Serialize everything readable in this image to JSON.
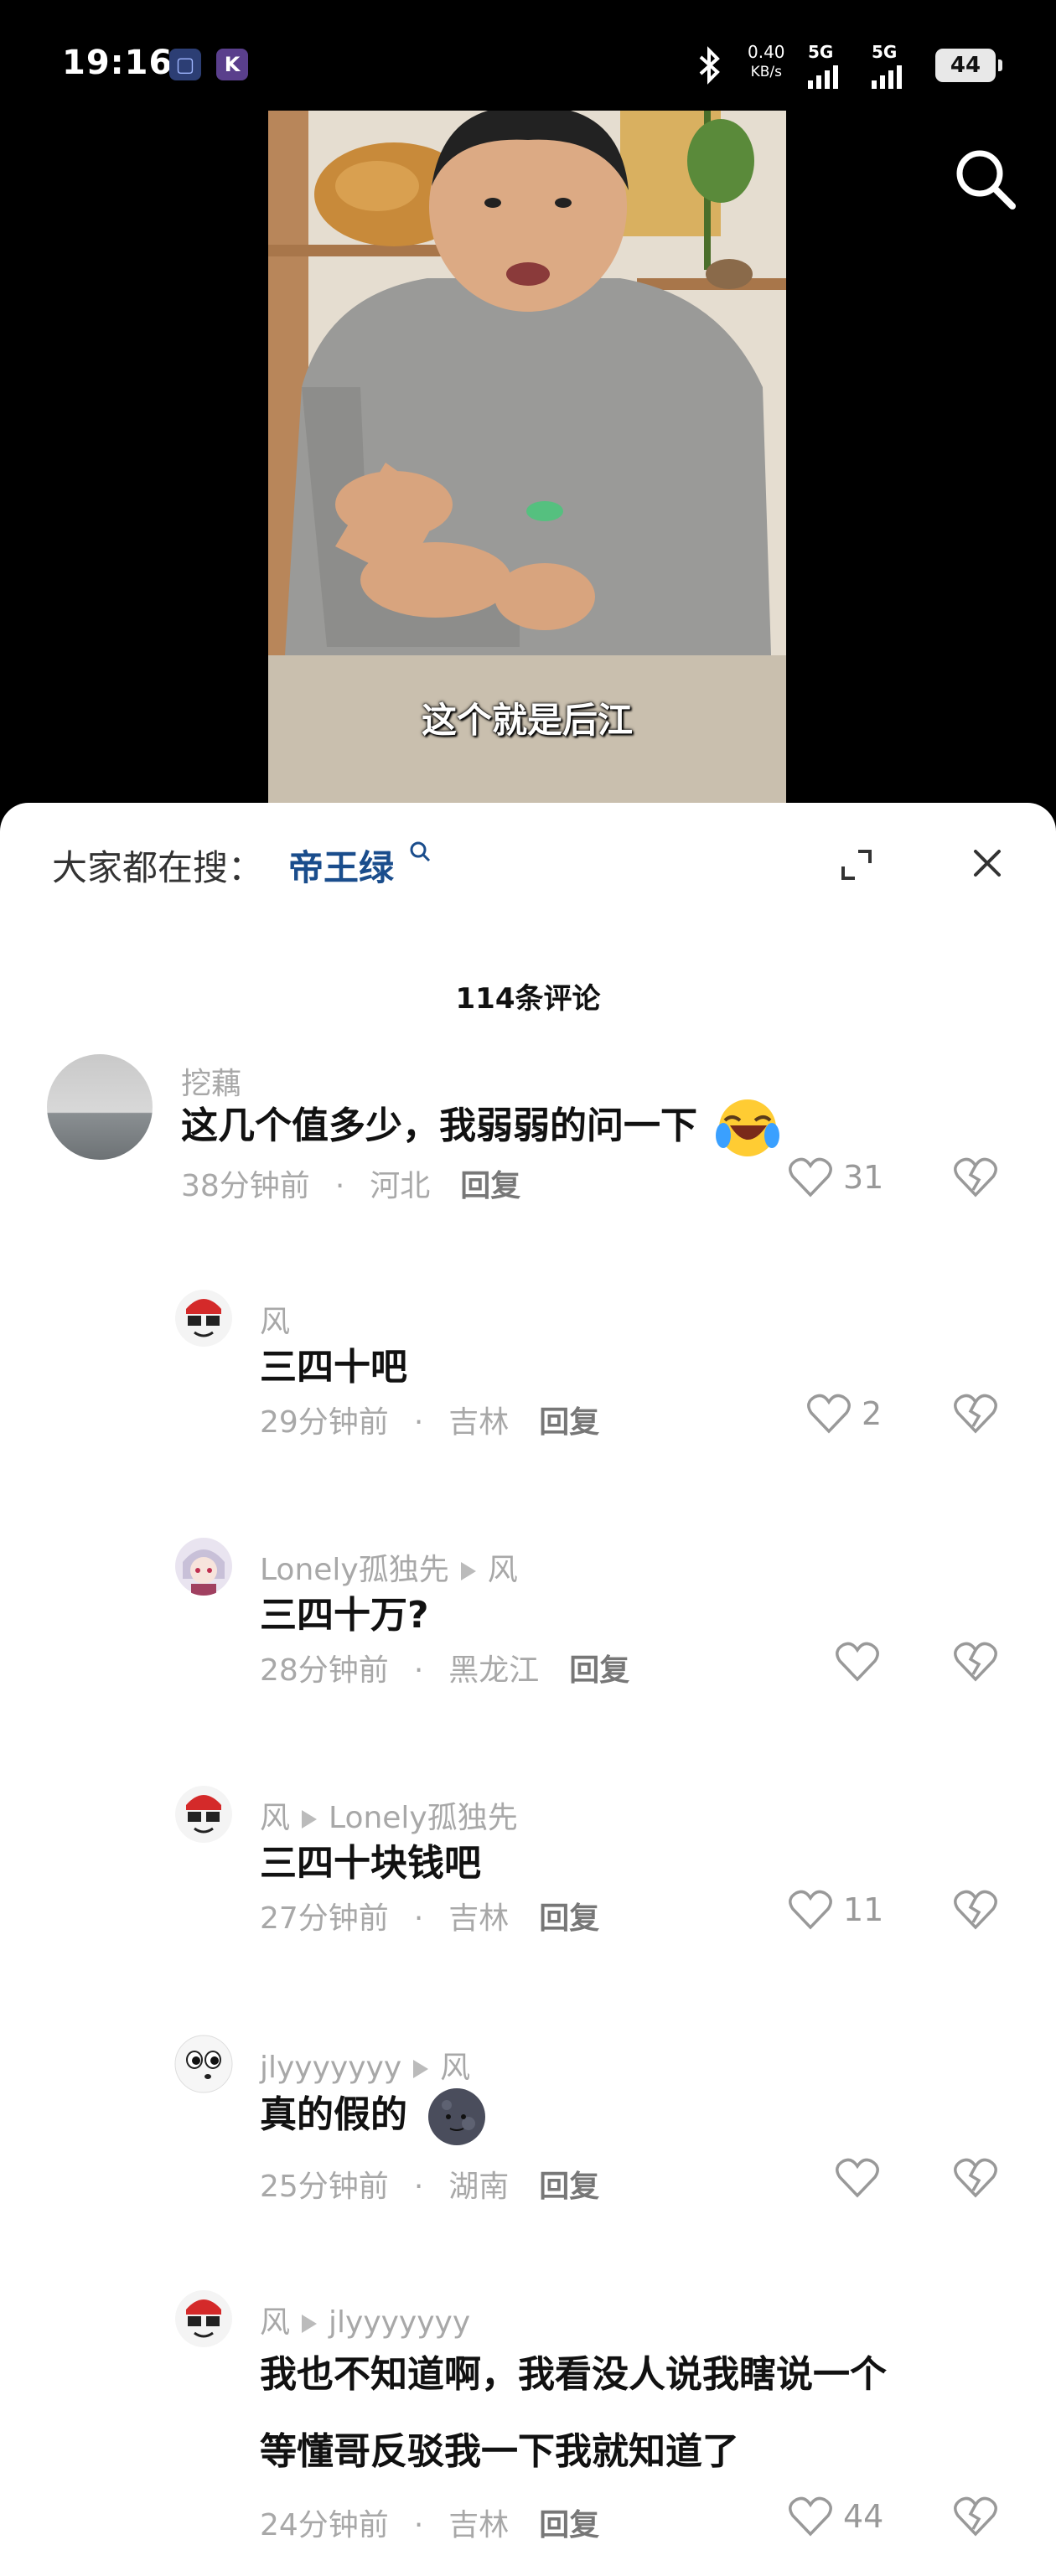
{
  "status_bar": {
    "time": "19:16",
    "app_badge_1": "▢",
    "app_badge_2": "K",
    "net_speed_value": "0.40",
    "net_speed_unit": "KB/s",
    "signal_1_label": "5G",
    "signal_2_label": "5G",
    "battery": "44"
  },
  "video": {
    "subtitle": "这个就是后江"
  },
  "sheet": {
    "search_prefix": "大家都在搜：",
    "search_keyword": "帝王绿",
    "comment_count": "114条评论"
  },
  "comments": [
    {
      "user": "挖藕",
      "text": "这几个值多少，我弱弱的问一下",
      "time": "38分钟前",
      "location": "河北",
      "reply_label": "回复",
      "likes": "31"
    },
    {
      "user": "风",
      "text": "三四十吧",
      "time": "29分钟前",
      "location": "吉林",
      "reply_label": "回复",
      "likes": "2"
    },
    {
      "user": "Lonely孤独先",
      "reply_to": "风",
      "text": "三四十万?",
      "time": "28分钟前",
      "location": "黑龙江",
      "reply_label": "回复",
      "likes": ""
    },
    {
      "user": "风",
      "reply_to": "Lonely孤独先",
      "text": "三四十块钱吧",
      "time": "27分钟前",
      "location": "吉林",
      "reply_label": "回复",
      "likes": "11"
    },
    {
      "user": "jlyyyyyyy",
      "reply_to": "风",
      "text": "真的假的",
      "time": "25分钟前",
      "location": "湖南",
      "reply_label": "回复",
      "likes": ""
    },
    {
      "user": "风",
      "reply_to": "jlyyyyyyy",
      "text_line1": "我也不知道啊，我看没人说我瞎说一个",
      "text_line2": "等懂哥反驳我一下我就知道了",
      "time": "24分钟前",
      "location": "吉林",
      "reply_label": "回复",
      "likes": "44"
    }
  ],
  "colors": {
    "keyword": "#1a4d8c",
    "meta_gray": "#a8a8a8",
    "text": "#111111",
    "sheet_bg": "#ffffff"
  },
  "icons": [
    "search-icon",
    "expand-icon",
    "close-icon",
    "heart-icon",
    "dislike-icon",
    "bluetooth-icon",
    "signal-icon",
    "battery-icon"
  ]
}
